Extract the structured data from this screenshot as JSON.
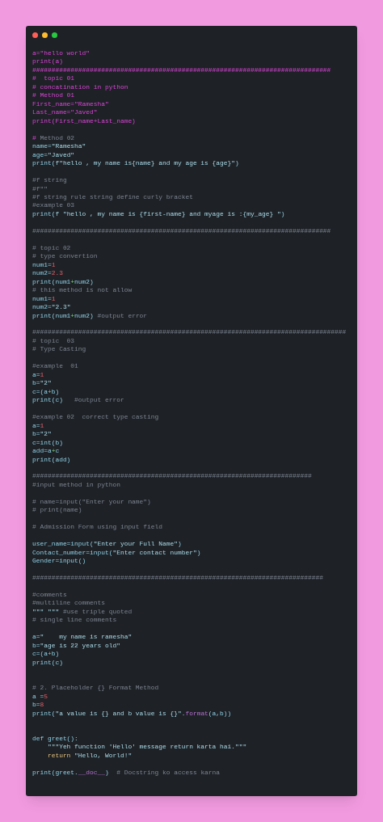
{
  "lines": [
    {
      "parts": [
        {
          "kind": "magenta",
          "text": "a=\"hello world\""
        }
      ]
    },
    {
      "parts": [
        {
          "kind": "magenta",
          "text": "print(a)"
        }
      ]
    },
    {
      "parts": [
        {
          "kind": "magenta",
          "text": "##############################################################################"
        }
      ]
    },
    {
      "parts": [
        {
          "kind": "magenta",
          "text": "#  topic 01"
        }
      ]
    },
    {
      "parts": [
        {
          "kind": "magenta",
          "text": "# concatination in python"
        }
      ]
    },
    {
      "parts": [
        {
          "kind": "magenta",
          "text": "# Method 01"
        }
      ]
    },
    {
      "parts": [
        {
          "kind": "magenta",
          "text": "First_name=\"Ramesha\""
        }
      ]
    },
    {
      "parts": [
        {
          "kind": "magenta",
          "text": "Last_name=\"Javed\""
        }
      ]
    },
    {
      "parts": [
        {
          "kind": "magenta",
          "text": "print(First_name+Last_name)"
        }
      ]
    },
    {
      "gap_before": true,
      "parts": [
        {
          "kind": "magenta",
          "text": "# "
        },
        {
          "kind": "comment",
          "text": "Method 02"
        }
      ]
    },
    {
      "parts": [
        {
          "kind": "code",
          "text": "name="
        },
        {
          "kind": "string",
          "text": "\"Ramesha\""
        }
      ]
    },
    {
      "parts": [
        {
          "kind": "code",
          "text": "age="
        },
        {
          "kind": "string",
          "text": "\"Javed\""
        }
      ]
    },
    {
      "parts": [
        {
          "kind": "code",
          "text": "print("
        },
        {
          "kind": "string",
          "text": "f\"hello , my name is{name} and my age is {age}\""
        },
        {
          "kind": "code",
          "text": ")"
        }
      ]
    },
    {
      "gap_before": true,
      "parts": [
        {
          "kind": "comment",
          "text": "#f string"
        }
      ]
    },
    {
      "parts": [
        {
          "kind": "comment",
          "text": "#f\"\""
        }
      ]
    },
    {
      "parts": [
        {
          "kind": "comment",
          "text": "#f string rule string define curly bracket"
        }
      ]
    },
    {
      "parts": [
        {
          "kind": "comment",
          "text": "#example 03"
        }
      ]
    },
    {
      "parts": [
        {
          "kind": "code",
          "text": "print("
        },
        {
          "kind": "string",
          "text": "f \"hello , my name is {first-name} and myage is :{my_age} \""
        },
        {
          "kind": "code",
          "text": ")"
        }
      ]
    },
    {
      "gap_before": true,
      "parts": [
        {
          "kind": "comment",
          "text": "##############################################################################"
        }
      ]
    },
    {
      "gap_before": true,
      "parts": [
        {
          "kind": "comment",
          "text": "# topic 02"
        }
      ]
    },
    {
      "parts": [
        {
          "kind": "comment",
          "text": "# type convertion"
        }
      ]
    },
    {
      "parts": [
        {
          "kind": "code",
          "text": "num1="
        },
        {
          "kind": "number",
          "text": "1"
        }
      ]
    },
    {
      "parts": [
        {
          "kind": "code",
          "text": "num2="
        },
        {
          "kind": "number",
          "text": "2.3"
        }
      ]
    },
    {
      "parts": [
        {
          "kind": "code",
          "text": "print(num1"
        },
        {
          "kind": "operator",
          "text": "+"
        },
        {
          "kind": "code",
          "text": "num2)"
        }
      ]
    },
    {
      "parts": [
        {
          "kind": "comment",
          "text": "# this method is not allow"
        }
      ]
    },
    {
      "parts": [
        {
          "kind": "code",
          "text": "num1="
        },
        {
          "kind": "number",
          "text": "1"
        }
      ]
    },
    {
      "parts": [
        {
          "kind": "code",
          "text": "num2="
        },
        {
          "kind": "string",
          "text": "\"2.3\""
        }
      ]
    },
    {
      "parts": [
        {
          "kind": "code",
          "text": "print(num1"
        },
        {
          "kind": "operator",
          "text": "+"
        },
        {
          "kind": "code",
          "text": "num2) "
        },
        {
          "kind": "comment",
          "text": "#output error"
        }
      ]
    },
    {
      "gap_before": true,
      "parts": [
        {
          "kind": "comment",
          "text": "##################################################################################"
        }
      ]
    },
    {
      "parts": [
        {
          "kind": "comment",
          "text": "# topic  03"
        }
      ]
    },
    {
      "parts": [
        {
          "kind": "comment",
          "text": "# Type Casting"
        }
      ]
    },
    {
      "gap_before": true,
      "parts": [
        {
          "kind": "comment",
          "text": "#example  01"
        }
      ]
    },
    {
      "parts": [
        {
          "kind": "code",
          "text": "a="
        },
        {
          "kind": "number",
          "text": "1"
        }
      ]
    },
    {
      "parts": [
        {
          "kind": "code",
          "text": "b="
        },
        {
          "kind": "string",
          "text": "\"2\""
        }
      ]
    },
    {
      "parts": [
        {
          "kind": "code",
          "text": "c=(a"
        },
        {
          "kind": "operator",
          "text": "+"
        },
        {
          "kind": "code",
          "text": "b)"
        }
      ]
    },
    {
      "parts": [
        {
          "kind": "code",
          "text": "print(c)   "
        },
        {
          "kind": "comment",
          "text": "#output error"
        }
      ]
    },
    {
      "gap_before": true,
      "parts": [
        {
          "kind": "comment",
          "text": "#example 02  correct type casting"
        }
      ]
    },
    {
      "parts": [
        {
          "kind": "code",
          "text": "a="
        },
        {
          "kind": "number",
          "text": "1"
        }
      ]
    },
    {
      "parts": [
        {
          "kind": "code",
          "text": "b="
        },
        {
          "kind": "string",
          "text": "\"2\""
        }
      ]
    },
    {
      "parts": [
        {
          "kind": "code",
          "text": "c=int(b)"
        }
      ]
    },
    {
      "parts": [
        {
          "kind": "code",
          "text": "add=a"
        },
        {
          "kind": "operator",
          "text": "+"
        },
        {
          "kind": "code",
          "text": "c"
        }
      ]
    },
    {
      "parts": [
        {
          "kind": "code",
          "text": "print(add)"
        }
      ]
    },
    {
      "gap_before": true,
      "parts": [
        {
          "kind": "comment",
          "text": "#########################################################################"
        }
      ]
    },
    {
      "parts": [
        {
          "kind": "comment",
          "text": "#input method in python"
        }
      ]
    },
    {
      "gap_before": true,
      "parts": [
        {
          "kind": "comment",
          "text": "# name=input(\"Enter your name\")"
        }
      ]
    },
    {
      "parts": [
        {
          "kind": "comment",
          "text": "# print(name)"
        }
      ]
    },
    {
      "gap_before": true,
      "parts": [
        {
          "kind": "comment",
          "text": "# Admission Form using input field"
        }
      ]
    },
    {
      "gap_before": true,
      "parts": [
        {
          "kind": "code",
          "text": "user_name=input("
        },
        {
          "kind": "string",
          "text": "\"Enter your Full Name\""
        },
        {
          "kind": "code",
          "text": ")"
        }
      ]
    },
    {
      "parts": [
        {
          "kind": "code",
          "text": "Contact_number=input("
        },
        {
          "kind": "string",
          "text": "\"Enter contact number\""
        },
        {
          "kind": "code",
          "text": ")"
        }
      ]
    },
    {
      "parts": [
        {
          "kind": "code",
          "text": "Gender=input()"
        }
      ]
    },
    {
      "gap_before": true,
      "parts": [
        {
          "kind": "comment",
          "text": "############################################################################"
        }
      ]
    },
    {
      "gap_before": true,
      "parts": [
        {
          "kind": "comment",
          "text": "#comments"
        }
      ]
    },
    {
      "parts": [
        {
          "kind": "comment",
          "text": "#multiline comments"
        }
      ]
    },
    {
      "parts": [
        {
          "kind": "string",
          "text": "\"\"\" \"\"\" "
        },
        {
          "kind": "comment",
          "text": "#use triple quoted"
        }
      ]
    },
    {
      "parts": [
        {
          "kind": "comment",
          "text": "# single line comments"
        }
      ]
    },
    {
      "gap_before": true,
      "parts": [
        {
          "kind": "code",
          "text": "a="
        },
        {
          "kind": "string",
          "text": "\"    my name is ramesha\""
        }
      ]
    },
    {
      "parts": [
        {
          "kind": "code",
          "text": "b="
        },
        {
          "kind": "string",
          "text": "\"age is 22 years old\""
        }
      ]
    },
    {
      "parts": [
        {
          "kind": "code",
          "text": "c=(a"
        },
        {
          "kind": "operator",
          "text": "+"
        },
        {
          "kind": "code",
          "text": "b)"
        }
      ]
    },
    {
      "parts": [
        {
          "kind": "code",
          "text": "print(c)"
        }
      ]
    },
    {
      "gap_before": true,
      "extra_gap": true,
      "parts": [
        {
          "kind": "comment",
          "text": "# 2. Placeholder {} Format Method"
        }
      ]
    },
    {
      "parts": [
        {
          "kind": "code",
          "text": "a ="
        },
        {
          "kind": "number",
          "text": "5"
        }
      ]
    },
    {
      "parts": [
        {
          "kind": "code",
          "text": "b="
        },
        {
          "kind": "number",
          "text": "8"
        }
      ]
    },
    {
      "parts": [
        {
          "kind": "code",
          "text": "print("
        },
        {
          "kind": "string",
          "text": "\"a value is {} and b value is {}\""
        },
        {
          "kind": "code",
          "text": "."
        },
        {
          "kind": "method",
          "text": "format"
        },
        {
          "kind": "code",
          "text": "(a,b))"
        }
      ]
    },
    {
      "gap_before": true,
      "extra_gap": true,
      "parts": [
        {
          "kind": "code",
          "text": "def greet():"
        }
      ]
    },
    {
      "parts": [
        {
          "kind": "string",
          "text": "    \"\"\"Yeh function 'Hello' message return karta hai.\"\"\""
        }
      ]
    },
    {
      "parts": [
        {
          "kind": "keyword",
          "text": "    return "
        },
        {
          "kind": "string",
          "text": "\"Hello, World!\""
        }
      ]
    },
    {
      "gap_before": true,
      "parts": [
        {
          "kind": "code",
          "text": "print(greet."
        },
        {
          "kind": "method",
          "text": "__doc__"
        },
        {
          "kind": "code",
          "text": ")  "
        },
        {
          "kind": "comment",
          "text": "# Docstring ko access karna"
        }
      ]
    }
  ]
}
